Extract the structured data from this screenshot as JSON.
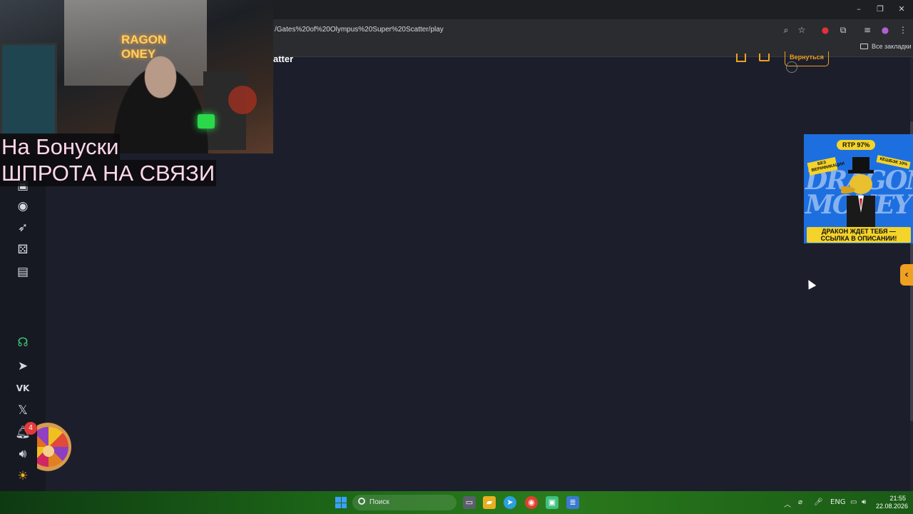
{
  "browser": {
    "url": "/Gates%20of%20Olympus%20Super%20Scatter/play",
    "bookmarks_label": "Все закладки"
  },
  "page": {
    "game_title_visible": "atter",
    "back_button": "Вернуться"
  },
  "sidebar": {
    "notifications_count": "4"
  },
  "promo": {
    "rtp": "RTP 97%",
    "no_verification": "БЕЗ ВЕРИФИКАЦИИ",
    "cashback": "КЕШБЭК 10%",
    "scribble": "DRAGON MONEY",
    "cta": "ДРАКОН ЖДЕТ ТЕБЯ — ССЫЛКА В ОПИСАНИИ!"
  },
  "webcam": {
    "neon_sign": "RAGON\nONEY"
  },
  "overlay": {
    "line1": "На Бонуски",
    "line2": "ШПРОТА НА СВЯЗИ"
  },
  "taskbar": {
    "search_placeholder": "Поиск",
    "language": "ENG",
    "time": "21:55",
    "date": "22.08.2026"
  },
  "colors": {
    "accent": "#f0a020",
    "page_bg": "#1c1f2b",
    "promo_bg": "#1d6fe0",
    "promo_yellow": "#f4d32a"
  }
}
